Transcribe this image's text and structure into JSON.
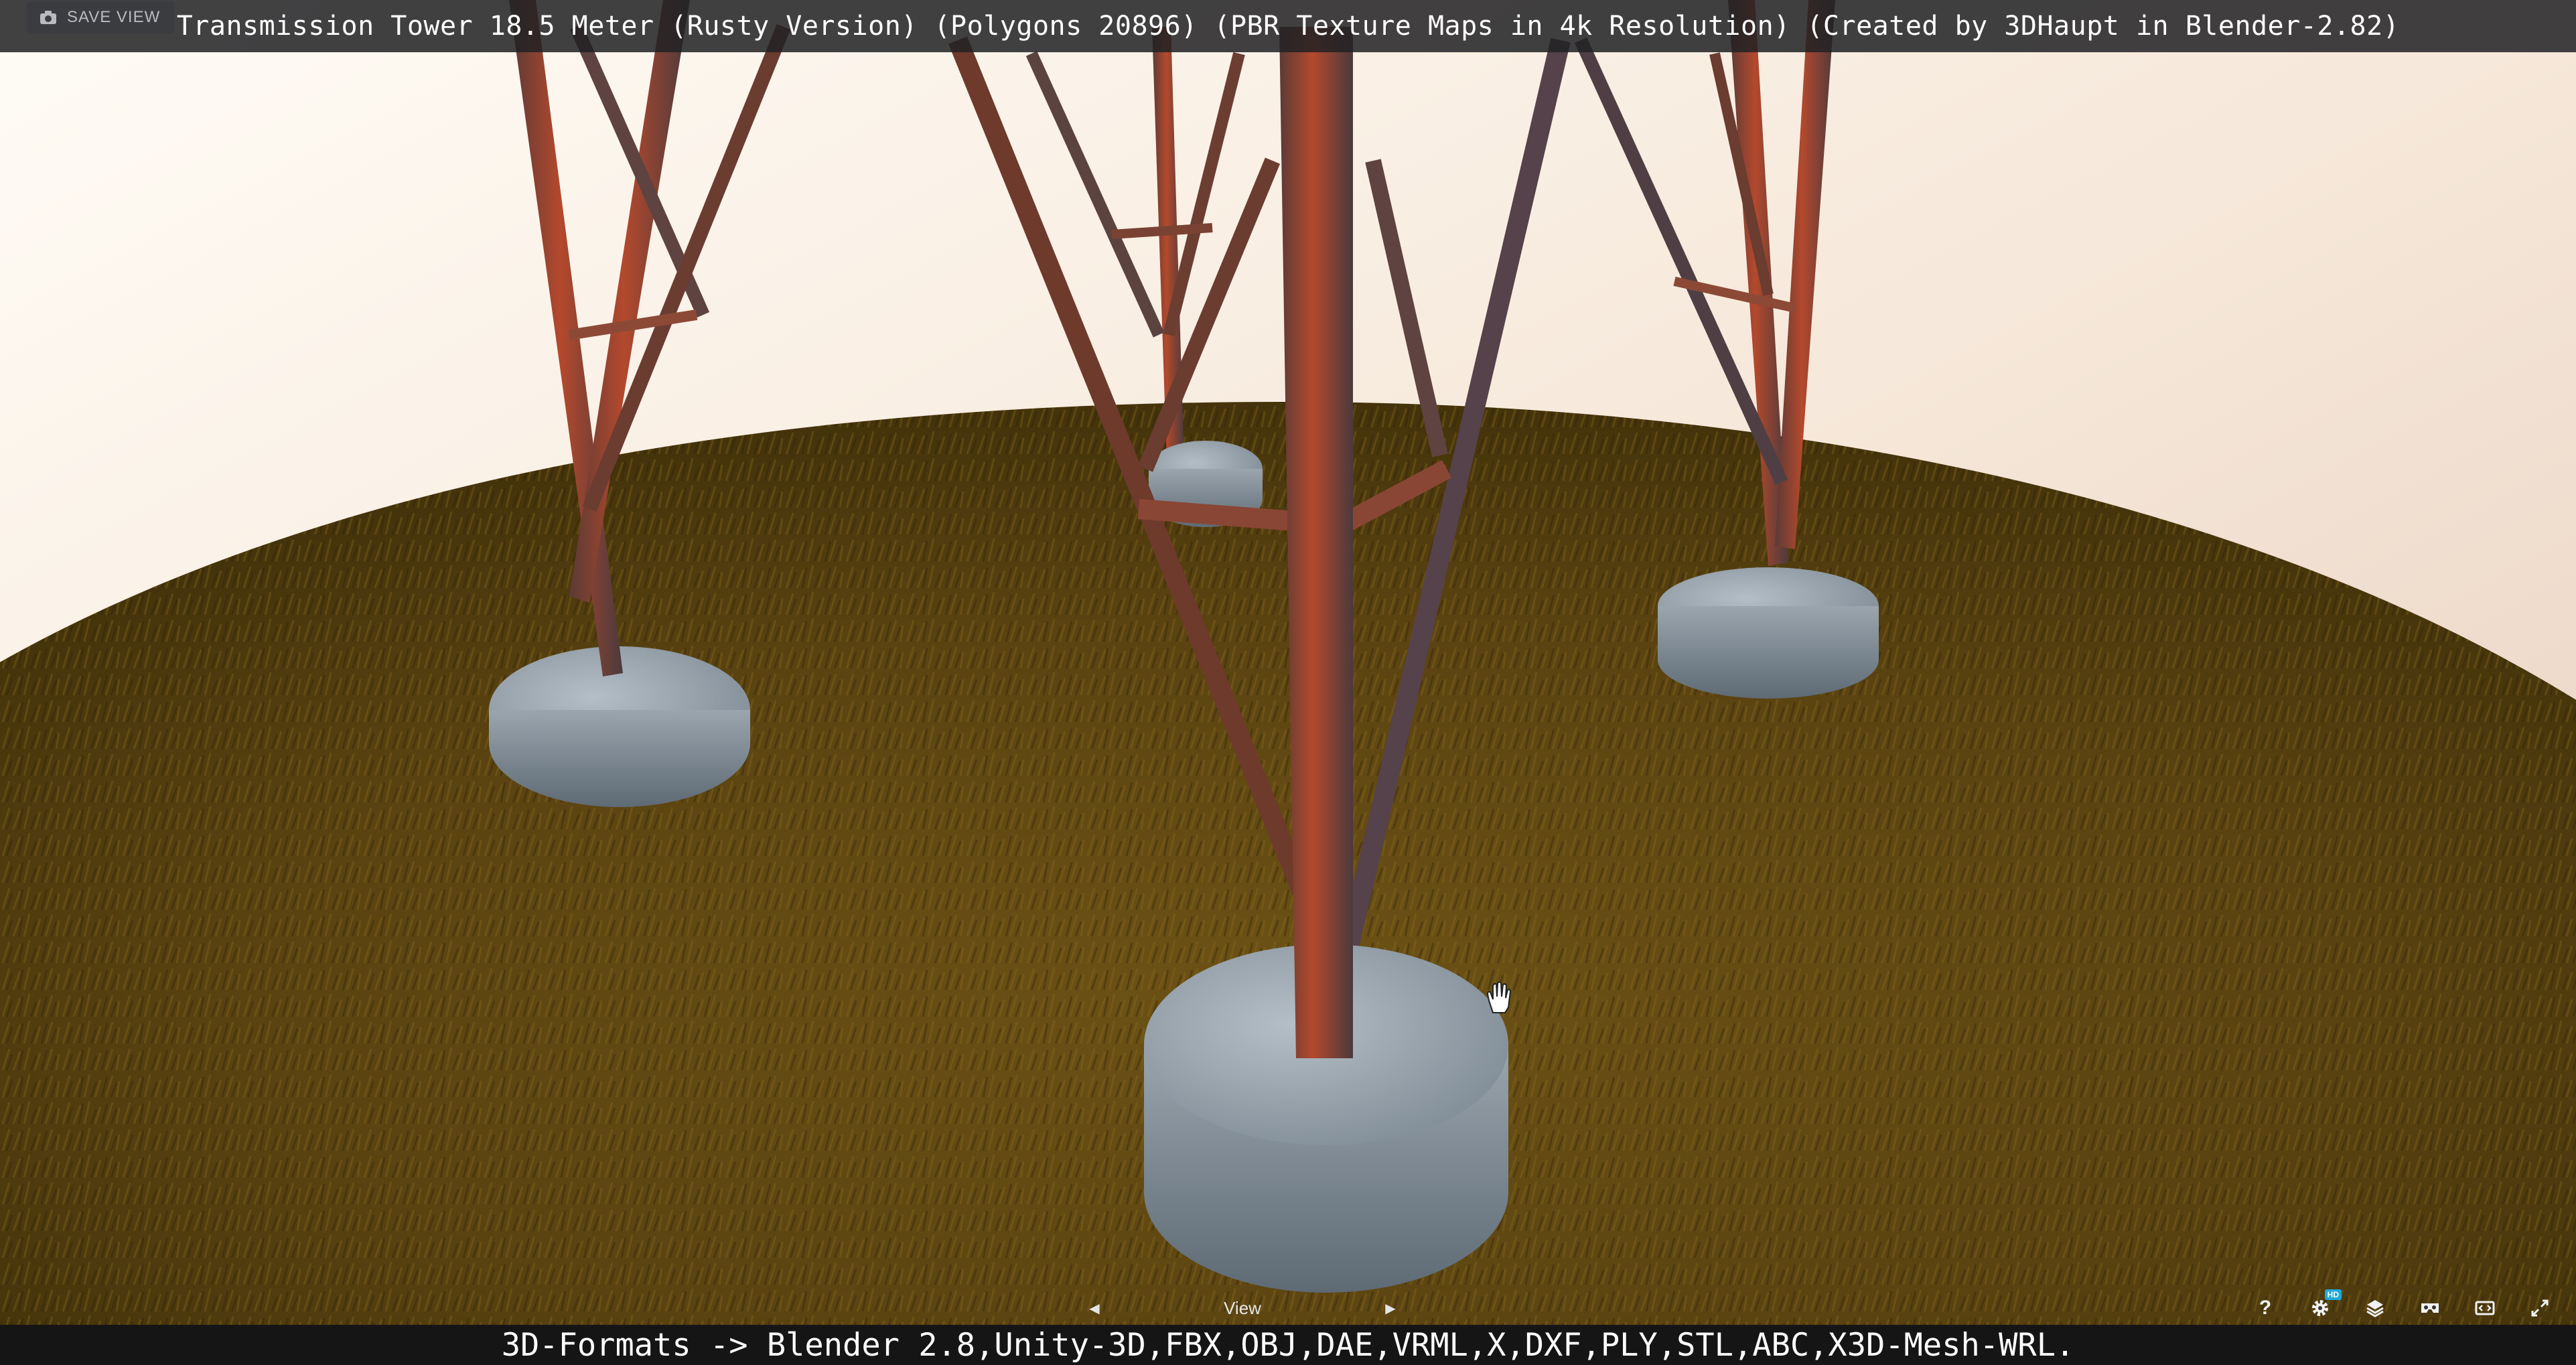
{
  "header": {
    "save_view_label": "SAVE VIEW",
    "model_title": "Transmission Tower 18.5 Meter (Rusty Version) (Polygons 20896) (PBR Texture Maps in 4k Resolution) (Created by 3DHaupt in Blender-2.82)"
  },
  "footer": {
    "formats_text": "3D-Formats -> Blender 2.8,Unity-3D,FBX,OBJ,DAE,VRML,X,DXF,PLY,STL,ABC,X3D-Mesh-WRL."
  },
  "view_nav": {
    "label": "View",
    "prev_icon": "chevron-left-icon",
    "next_icon": "chevron-right-icon"
  },
  "controls": {
    "help_label": "?",
    "hd_badge": "HD",
    "icons": [
      "help-icon",
      "settings-icon",
      "layers-icon",
      "vr-icon",
      "embed-icon",
      "fullscreen-icon"
    ]
  },
  "colors": {
    "bar_background": "#222224",
    "bottom_strip": "#151516",
    "sky_light": "#fbf1e6",
    "sky_warm": "#ead2c0",
    "grass_dark": "#3b2d0a",
    "grass_mid": "#6a5214",
    "rust": "#b0442a",
    "concrete": "#8e9aa4",
    "hd_badge": "#1caad9"
  }
}
